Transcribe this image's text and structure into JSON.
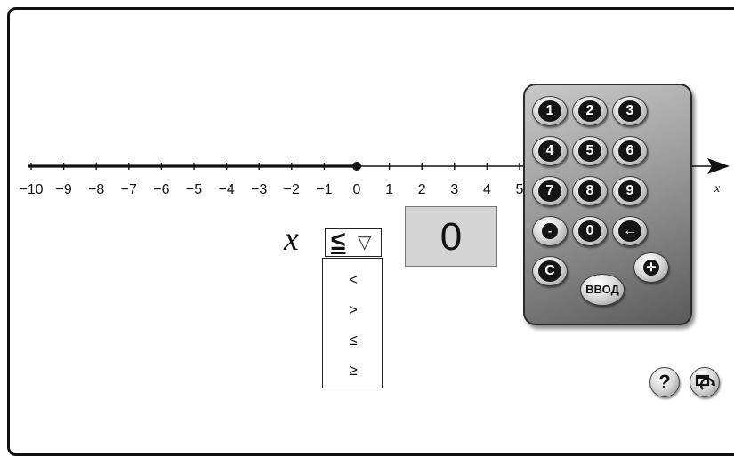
{
  "number_line": {
    "tick_labels": [
      "−10",
      "−9",
      "−8",
      "−7",
      "−6",
      "−5",
      "−4",
      "−3",
      "−2",
      "−1",
      "0",
      "1",
      "2",
      "3",
      "4",
      "5"
    ],
    "axis_label": "x",
    "marked_point": 0,
    "shaded_ray": "left",
    "point_closed": true
  },
  "inequality": {
    "variable": "x",
    "selected_operator": "≤",
    "dropdown_caret": "▽",
    "options": [
      "<",
      ">",
      "≤",
      "≥"
    ]
  },
  "answer_box": {
    "value": "0"
  },
  "keypad": {
    "keys": [
      "1",
      "2",
      "3",
      "4",
      "5",
      "6",
      "7",
      "8",
      "9",
      "-",
      "0",
      "←",
      "C",
      "ВВОД",
      "✛"
    ]
  },
  "tools": {
    "help_icon": "help-icon",
    "reset_icon": "reset-icon",
    "help_label": "?"
  }
}
